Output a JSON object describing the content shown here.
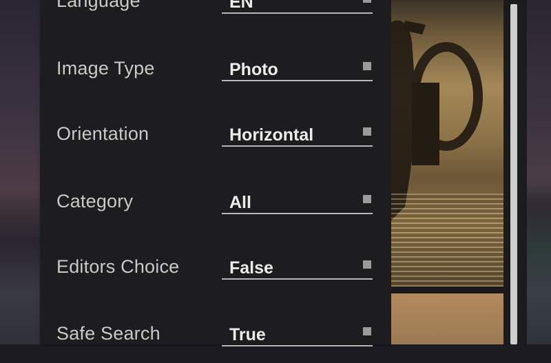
{
  "settings": {
    "rows": [
      {
        "label": "Language",
        "value": "EN"
      },
      {
        "label": "Image Type",
        "value": "Photo"
      },
      {
        "label": "Orientation",
        "value": "Horizontal"
      },
      {
        "label": "Category",
        "value": "All"
      },
      {
        "label": "Editors Choice",
        "value": "False"
      },
      {
        "label": "Safe Search",
        "value": "True"
      }
    ]
  },
  "colors": {
    "panel_background": "#1d1d1f",
    "label_text": "#c9c9c9",
    "value_text": "#ececec",
    "underline": "#b8b8b8",
    "dropdown_marker": "#9b9b9b"
  },
  "icons": {
    "dropdown_marker": "square-dropdown-marker-icon"
  }
}
